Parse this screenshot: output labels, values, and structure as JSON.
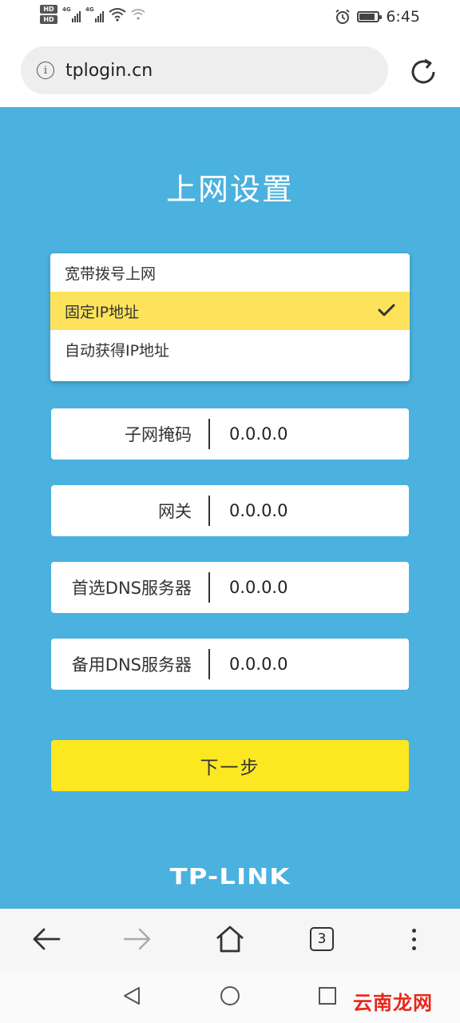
{
  "status_bar": {
    "hd_badges": [
      "HD",
      "HD"
    ],
    "network_labels": [
      "4G",
      "4G"
    ],
    "time": "6:45",
    "battery_level": 0.85
  },
  "url_bar": {
    "url": "tplogin.cn",
    "info_icon_glyph": "i"
  },
  "page": {
    "title": "上网设置",
    "background_color": "#4bb1df",
    "connection_type_options": [
      {
        "label": "宽带拨号上网",
        "selected": false
      },
      {
        "label": "固定IP地址",
        "selected": true
      },
      {
        "label": "自动获得IP地址",
        "selected": false
      }
    ],
    "fields": [
      {
        "label": "子网掩码",
        "value": "0.0.0.0"
      },
      {
        "label": "网关",
        "value": "0.0.0.0"
      },
      {
        "label": "首选DNS服务器",
        "value": "0.0.0.0"
      },
      {
        "label": "备用DNS服务器",
        "value": "0.0.0.0"
      }
    ],
    "next_button_label": "下一步",
    "next_button_color": "#fce820",
    "selected_option_color": "#fde35c",
    "brand_logo": "TP-LINK"
  },
  "browser_toolbar": {
    "tab_count": "3"
  },
  "watermark": "云南龙网"
}
